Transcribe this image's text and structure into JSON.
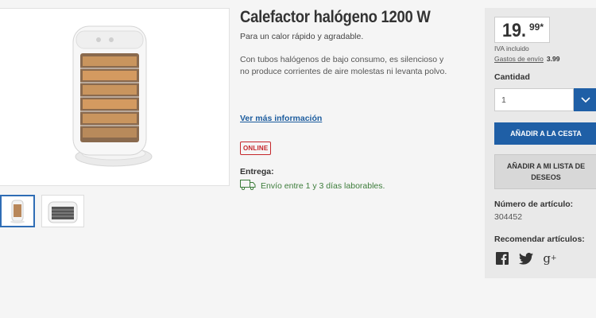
{
  "product": {
    "title": "Calefactor halógeno 1200 W",
    "subtitle": "Para un calor rápido y agradable.",
    "description": "Con tubos halógenos de bajo consumo, es silencioso y no produce corrientes de aire molestas ni levanta polvo.",
    "more_info_link": "Ver más información",
    "badge": "ONLINE",
    "delivery_label": "Entrega:",
    "delivery_text": "Envío entre 1 y 3 días laborables."
  },
  "purchase": {
    "price_int": "19.",
    "price_dec": "99*",
    "vat_note": "IVA incluido",
    "shipping_label": "Gastos de envío",
    "shipping_value": "3.99",
    "quantity_label": "Cantidad",
    "quantity_value": "1",
    "add_to_cart": "AÑADIR A LA CESTA",
    "add_to_wishlist": "AÑADIR A MI LISTA DE DESEOS",
    "article_label": "Número de artículo:",
    "article_number": "304452",
    "recommend_label": "Recomendar artículos:"
  },
  "icons": {
    "truck": "truck-icon",
    "chevron": "chevron-down-icon",
    "facebook": "facebook-icon",
    "twitter": "twitter-icon",
    "gplus": "google-plus-icon"
  },
  "colors": {
    "accent": "#1f5fa6",
    "badge": "#c5262b",
    "delivery": "#3c7c3a"
  }
}
